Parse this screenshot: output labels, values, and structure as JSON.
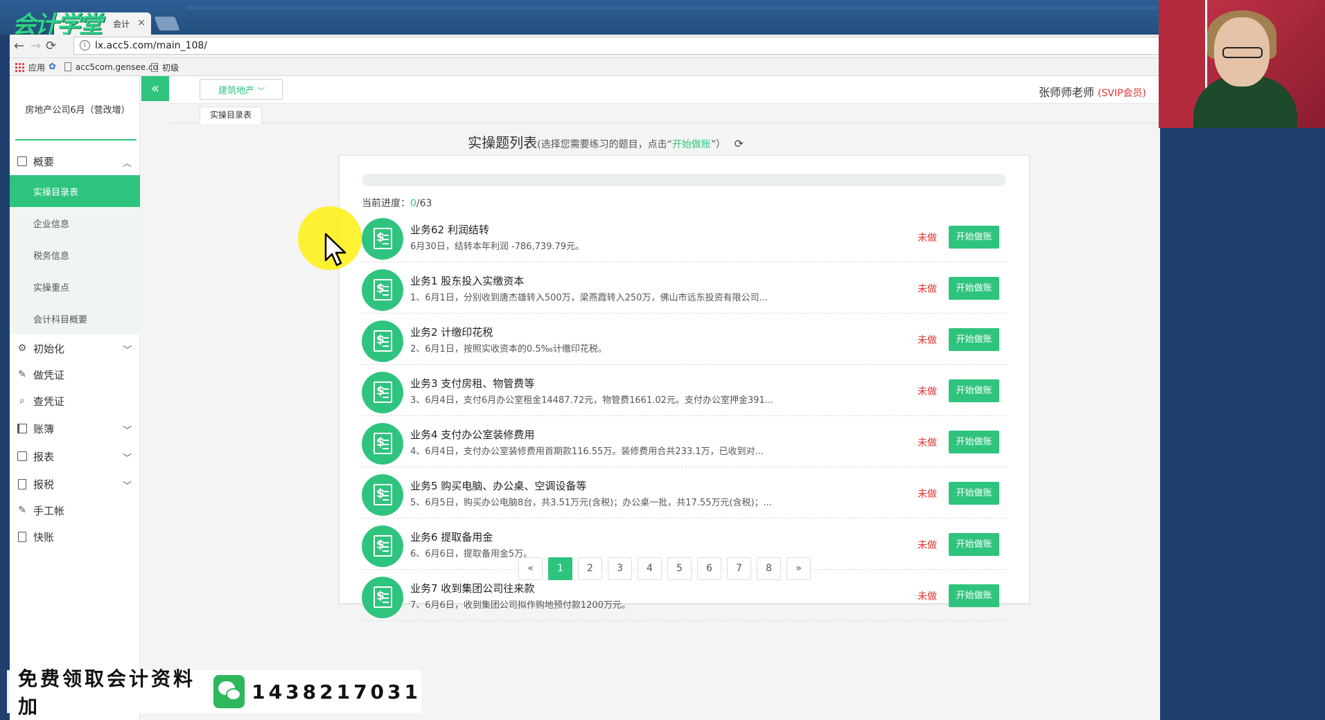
{
  "browser": {
    "brand_logo": "会计学堂",
    "tab_title": "会计",
    "tab_close": "×",
    "address": "lx.acc5.com/main_108/",
    "bookmarks": [
      "应用",
      "acc5com.gensee.co",
      "初级"
    ]
  },
  "sidebar": {
    "company": "房地产公司6月（营改增）",
    "groups": [
      {
        "label": "概要",
        "icon": "dashboard-icon",
        "expanded": true,
        "items": [
          "实操目录表",
          "企业信息",
          "税务信息",
          "实操重点",
          "会计科目概要"
        ],
        "active_index": 0
      },
      {
        "label": "初始化",
        "icon": "gear-icon"
      },
      {
        "label": "做凭证",
        "icon": "pen-icon"
      },
      {
        "label": "查凭证",
        "icon": "search-icon"
      },
      {
        "label": "账簿",
        "icon": "book-icon"
      },
      {
        "label": "报表",
        "icon": "report-icon"
      },
      {
        "label": "报税",
        "icon": "document-icon"
      },
      {
        "label": "手工帐",
        "icon": "pen-icon"
      },
      {
        "label": "快账",
        "icon": "document-icon"
      }
    ]
  },
  "topbar": {
    "collapse": "«",
    "category": "建筑地产",
    "teacher": "张师师老师",
    "vip": "(SVIP会员)",
    "subtab": "实操目录表"
  },
  "heading": {
    "title": "实操题列表",
    "hint_prefix": "(选择您需要练习的题目，点击“",
    "hint_action": "开始做账",
    "hint_suffix": "”）"
  },
  "progress": {
    "label": "当前进度：",
    "done": "0",
    "total": "/63",
    "fraction": 0
  },
  "tasks": [
    {
      "title": "业务62 利润结转",
      "desc": "6月30日，结转本年利润 -786,739.79元。",
      "status": "未做",
      "button": "开始做账"
    },
    {
      "title": "业务1 股东投入实缴资本",
      "desc": "1、6月1日，分别收到唐杰雄转入500万，梁燕霞转入250万，佛山市远东投资有限公司...",
      "status": "未做",
      "button": "开始做账"
    },
    {
      "title": "业务2 计缴印花税",
      "desc": "2、6月1日，按照实收资本的0.5‰计缴印花税。",
      "status": "未做",
      "button": "开始做账"
    },
    {
      "title": "业务3 支付房租、物管费等",
      "desc": "3、6月4日，支付6月办公室租金14487.72元，物管费1661.02元。支付办公室押金391...",
      "status": "未做",
      "button": "开始做账"
    },
    {
      "title": "业务4 支付办公室装修费用",
      "desc": "4、6月4日，支付办公室装修费用首期款116.55万。装修费用合共233.1万，已收到对...",
      "status": "未做",
      "button": "开始做账"
    },
    {
      "title": "业务5 购买电脑、办公桌、空调设备等",
      "desc": "5、6月5日，购买办公电脑8台，共3.51万元(含税)；办公桌一批，共17.55万元(含税)；...",
      "status": "未做",
      "button": "开始做账"
    },
    {
      "title": "业务6 提取备用金",
      "desc": "6、6月6日，提取备用金5万。",
      "status": "未做",
      "button": "开始做账"
    },
    {
      "title": "业务7 收到集团公司往来款",
      "desc": "7、6月6日，收到集团公司拟作购地预付款1200万元。",
      "status": "未做",
      "button": "开始做账"
    }
  ],
  "pagination": {
    "prev": "«",
    "pages": [
      "1",
      "2",
      "3",
      "4",
      "5",
      "6",
      "7",
      "8"
    ],
    "active": "1",
    "next": "»"
  },
  "promo": {
    "text": "免费领取会计资料加",
    "phone": "1438217031"
  },
  "colors": {
    "accent": "#2ec47e",
    "status_red": "#e0332f"
  }
}
